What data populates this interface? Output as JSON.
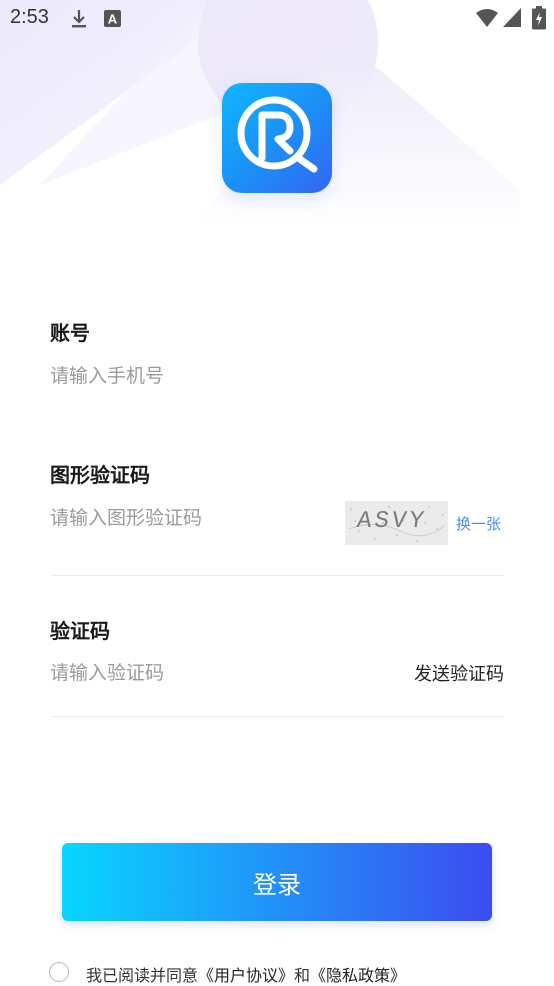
{
  "status_bar": {
    "time": "2:53",
    "icons": [
      "download-icon",
      "a-letter-icon",
      "wifi-icon",
      "signal-icon",
      "battery-icon"
    ]
  },
  "logo": {
    "icon": "r-magnifier-logo",
    "colors": [
      "#10b6ff",
      "#3466f4"
    ]
  },
  "form": {
    "account": {
      "label": "账号",
      "placeholder": "请输入手机号"
    },
    "captcha": {
      "label": "图形验证码",
      "placeholder": "请输入图形验证码",
      "image_text": "ASVY",
      "refresh_label": "换一张"
    },
    "sms": {
      "label": "验证码",
      "placeholder": "请输入验证码",
      "send_label": "发送验证码"
    }
  },
  "login_button": {
    "label": "登录",
    "gradient": [
      "#08d6ff",
      "#3c4cf0"
    ]
  },
  "agreement": {
    "prefix": "我已阅读并同意",
    "user_agreement": "《用户协议》",
    "and": "和",
    "privacy_policy": "《隐私政策》",
    "checked": false
  }
}
